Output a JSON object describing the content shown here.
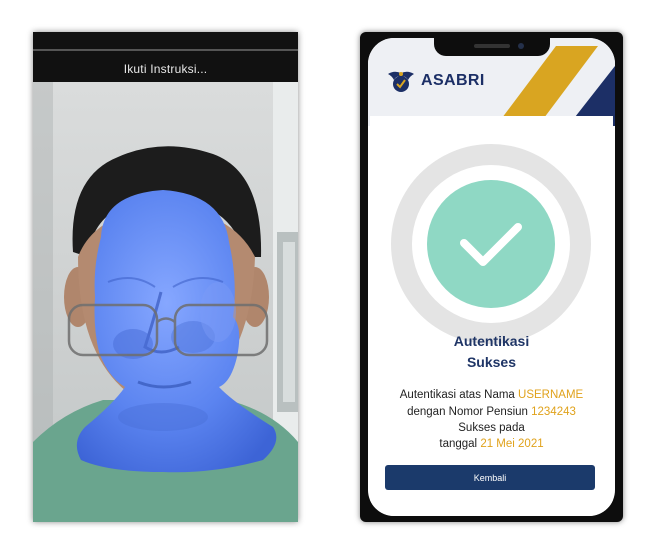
{
  "camera_panel": {
    "instruction": "Ikuti Instruksi..."
  },
  "app": {
    "brand_name": "ASABRI",
    "logo_icon": "asabri-emblem-icon",
    "colors": {
      "navy": "#1b3a6b",
      "gold": "#d9a521",
      "success_green": "#8fd8c4",
      "ring_gray": "#e4e4e4"
    }
  },
  "success": {
    "title_line1": "Autentikasi",
    "title_line2": "Sukses",
    "line1_prefix": "Autentikasi atas Nama ",
    "username": "USERNAME",
    "line2_prefix": "dengan Nomor Pensiun ",
    "pension_number": "1234243",
    "line3": "Sukses pada",
    "line4_prefix": "tanggal ",
    "date": "21 Mei 2021",
    "back_button_label": "Kembali"
  }
}
